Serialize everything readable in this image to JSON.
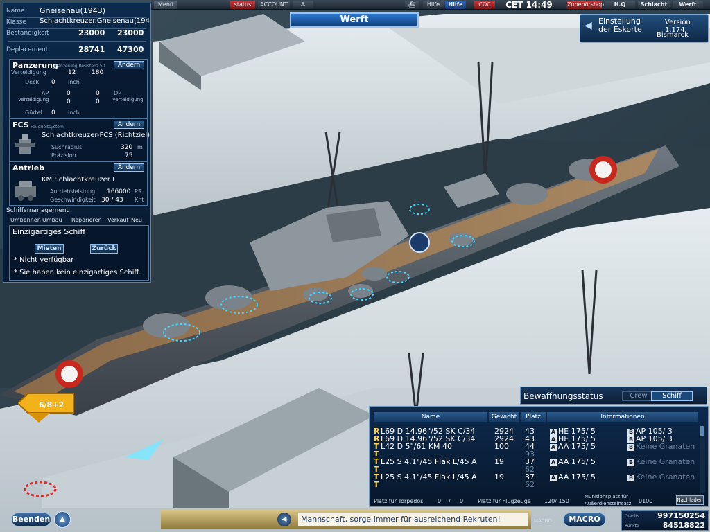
{
  "topbar": {
    "menu": "Menü",
    "status": "status",
    "account": "ACCOUNT",
    "hilfe1": "Hilfe",
    "hilfe2": "Hilfe",
    "coc": "COC",
    "time": "CET 14:49",
    "shop": "Zubehörshop",
    "hq": "H.Q",
    "schlacht": "Schlacht",
    "werft": "Werft"
  },
  "screen_title": "Werft",
  "escort": {
    "line1": "Einstellung",
    "line2": "der Eskorte",
    "version": "Version 1.174",
    "ship": "Bismarck"
  },
  "ship": {
    "name_label": "Name",
    "name": "Gneisenau(1943)",
    "class_label": "Klasse",
    "class": "Schlachtkreuzer.Gneisenau(194",
    "durability_label": "Beständigkeit",
    "durability_cur": "23000",
    "durability_max": "23000",
    "displacement_label": "Deplacement",
    "displacement_cur": "28741",
    "displacement_max": "47300"
  },
  "armor": {
    "title": "Panzerung",
    "subtitle": "Panzerung Resistenz 50",
    "change": "Ändern",
    "defense_label": "Verteidigung",
    "defense_a": "12",
    "defense_b": "180",
    "deck_label": "Deck",
    "deck_val": "0",
    "deck_unit": "inch",
    "ap_label": "AP",
    "ap_sub": "Verteidigung",
    "ap_a": "0",
    "ap_b": "0",
    "dp_label": "DP",
    "dp_sub": "Verteidigung",
    "dp_a": "0",
    "dp_b": "0",
    "belt_label": "Gürtel",
    "belt_val": "0",
    "belt_unit": "inch"
  },
  "fcs": {
    "title": "FCS",
    "subtitle": "Feuerleitsystem",
    "change": "Ändern",
    "name": "Schlachtkreuzer-FCS (Richtziel)",
    "radius_label": "Suchradius",
    "radius_val": "320",
    "radius_unit": "m",
    "precision_label": "Präzision",
    "precision_val": "75"
  },
  "drive": {
    "title": "Antrieb",
    "change": "Ändern",
    "name": "KM Schlachtkreuzer I",
    "power_label": "Antriebsleistung",
    "power_val": "166000",
    "power_unit": "PS",
    "speed_label": "Geschwindigkeit",
    "speed_val": "30 / 43",
    "speed_unit": "Knt"
  },
  "management": {
    "title": "Schiffsmanagement",
    "items": [
      "Umbennen",
      "Umbau",
      "Reparieren",
      "Verkauf",
      "Neu"
    ]
  },
  "unique_ship": {
    "title": "Einzigartiges Schiff",
    "rent": "Mieten",
    "back": "Zurück",
    "status1": "* Nicht verfügbar",
    "status2": "* Sie haben kein einzigartiges Schiff."
  },
  "weapons": {
    "title": "Bewaffnungsstatus",
    "tab_crew": "Crew",
    "tab_ship": "Schiff",
    "headers": {
      "name": "Name",
      "weight": "Gewicht",
      "slot": "Platz",
      "info": "Informationen"
    },
    "rows": [
      {
        "tag": "R",
        "name": "L69 D 14.96\"/52  SK C/34",
        "weight": "2924",
        "slot": "43",
        "a_badge": "A",
        "a_text": "HE  175/ 5",
        "b_badge": "B",
        "b_text": "AP  105/ 3"
      },
      {
        "tag": "R",
        "name": "L69 D 14.96\"/52  SK C/34",
        "weight": "2924",
        "slot": "43",
        "a_badge": "A",
        "a_text": "HE  175/ 5",
        "b_badge": "B",
        "b_text": "AP  105/ 3"
      },
      {
        "tag": "T",
        "name": "L42 D 5\"/61 KM 40",
        "weight": "100",
        "slot": "44",
        "a_badge": "A",
        "a_text": "AA  175/ 5",
        "b_badge": "B",
        "b_text": "Keine Granaten"
      },
      {
        "tag": "T",
        "name": "",
        "weight": "",
        "slot": "93",
        "a_badge": "",
        "a_text": "",
        "b_badge": "",
        "b_text": ""
      },
      {
        "tag": "T",
        "name": "L25 S 4.1\"/45 Flak L/45 A",
        "weight": "19",
        "slot": "37",
        "a_badge": "A",
        "a_text": "AA  175/ 5",
        "b_badge": "B",
        "b_text": "Keine Granaten"
      },
      {
        "tag": "T",
        "name": "",
        "weight": "",
        "slot": "62",
        "a_badge": "",
        "a_text": "",
        "b_badge": "",
        "b_text": ""
      },
      {
        "tag": "T",
        "name": "L25 S 4.1\"/45 Flak L/45 A",
        "weight": "19",
        "slot": "37",
        "a_badge": "A",
        "a_text": "AA  175/ 5",
        "b_badge": "B",
        "b_text": "Keine Granaten"
      },
      {
        "tag": "T",
        "name": "",
        "weight": "",
        "slot": "62",
        "a_badge": "",
        "a_text": "",
        "b_badge": "",
        "b_text": ""
      }
    ],
    "footer": {
      "torpedo_label": "Platz für Torpedos",
      "torpedo_a": "0",
      "torpedo_b": "0",
      "aircraft_label": "Platz für Flugzeuge",
      "aircraft_val": "120/  150",
      "ammo_label1": "Munitionsplatz für",
      "ammo_label2": "Außerdiensteinsatz",
      "ammo_val": "0100",
      "reload": "Nachladen"
    }
  },
  "bottombar": {
    "quit": "Beenden",
    "chat": "Mannschaft, sorge immer für ausreichend Rekruten!",
    "macro_label": "MACRO",
    "macro": "MACRO",
    "credits_label": "Credits",
    "credits": "997150254",
    "points_label": "Punkte",
    "points": "84518822"
  },
  "map_marker": "6/8+2",
  "colors": {
    "accent": "#2e7ad0",
    "panel": "#0c2a4c",
    "red_button": "#d23a3a",
    "rt_tag": "#ffd24a"
  }
}
